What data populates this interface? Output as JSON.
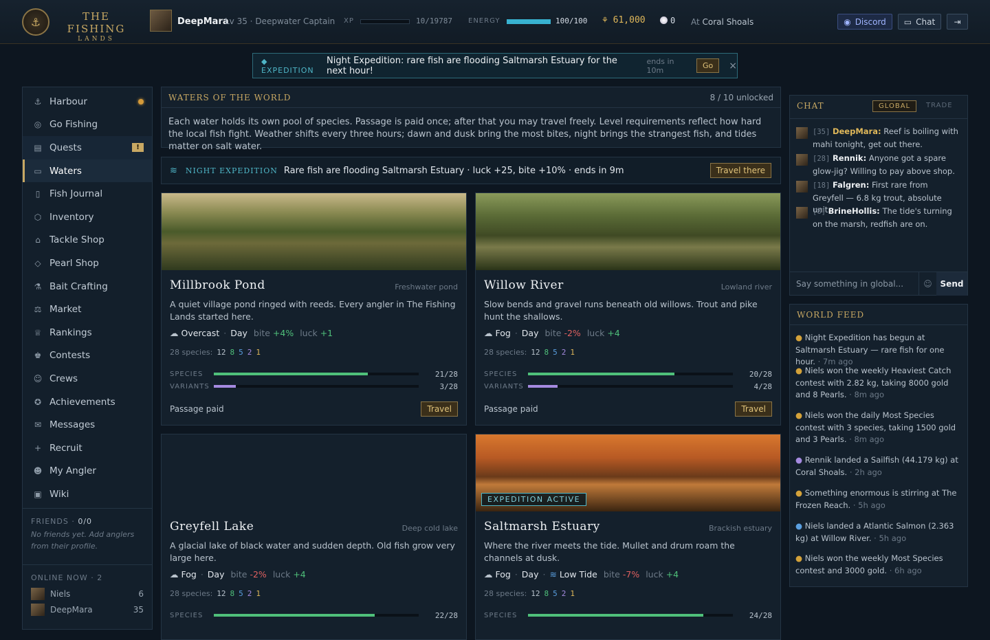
{
  "brand": {
    "line1": "THE FISHING",
    "line2": "LANDS"
  },
  "user": {
    "name": "DeepMara",
    "rank": "Lv 35 · Deepwater Captain",
    "xp_label": "XP",
    "xp_value": "10/19787",
    "xp_fraction": 0.0005,
    "energy_label": "ENERGY",
    "energy_value": "100/100",
    "energy_fraction": 1.0,
    "gold": "61,000",
    "pearls": "0",
    "location_prefix": "At",
    "location": "Coral Shoals"
  },
  "top_buttons": {
    "discord": "Discord",
    "chat": "Chat"
  },
  "banner": {
    "tag": "EXPEDITION",
    "message": "Night Expedition: rare fish are flooding Saltmarsh Estuary for the next hour!",
    "ends": "ends in 10m",
    "go": "Go",
    "close": "×"
  },
  "nav": [
    {
      "label": "Harbour",
      "icon": "⚓",
      "name": "harbour",
      "dot": true
    },
    {
      "label": "Go Fishing",
      "icon": "◎",
      "name": "go-fishing"
    },
    {
      "label": "Quests",
      "icon": "▤",
      "name": "quests",
      "badge": "!"
    },
    {
      "label": "Waters",
      "icon": "▭",
      "name": "waters",
      "active": true
    },
    {
      "label": "Fish Journal",
      "icon": "▯",
      "name": "fish-journal"
    },
    {
      "label": "Inventory",
      "icon": "⬡",
      "name": "inventory"
    },
    {
      "label": "Tackle Shop",
      "icon": "⌂",
      "name": "tackle-shop"
    },
    {
      "label": "Pearl Shop",
      "icon": "◇",
      "name": "pearl-shop"
    },
    {
      "label": "Bait Crafting",
      "icon": "⚗",
      "name": "bait-crafting"
    },
    {
      "label": "Market",
      "icon": "⚖",
      "name": "market"
    },
    {
      "label": "Rankings",
      "icon": "♕",
      "name": "rankings"
    },
    {
      "label": "Contests",
      "icon": "♚",
      "name": "contests"
    },
    {
      "label": "Crews",
      "icon": "☺",
      "name": "crews"
    },
    {
      "label": "Achievements",
      "icon": "✪",
      "name": "achievements"
    },
    {
      "label": "Messages",
      "icon": "✉",
      "name": "messages"
    },
    {
      "label": "Recruit",
      "icon": "+",
      "name": "recruit"
    },
    {
      "label": "My Angler",
      "icon": "☻",
      "name": "my-angler"
    },
    {
      "label": "Wiki",
      "icon": "▣",
      "name": "wiki"
    }
  ],
  "friends": {
    "label": "FRIENDS ·",
    "count": "0/0",
    "note": "No friends yet. Add anglers from their profile."
  },
  "online": {
    "label": "ONLINE NOW · 2",
    "users": [
      {
        "name": "Niels",
        "level": "6"
      },
      {
        "name": "DeepMara",
        "level": "35"
      }
    ]
  },
  "waters": {
    "title": "WATERS OF THE WORLD",
    "unlocked": "8 / 10 unlocked",
    "description": "Each water holds its own pool of species. Passage is paid once; after that you may travel freely. Level requirements reflect how hard the local fish fight. Weather shifts every three hours; dawn and dusk bring the most bites, night brings the strangest fish, and tides matter on salt water."
  },
  "night": {
    "tag": "NIGHT EXPEDITION",
    "message": "Rare fish are flooding Saltmarsh Estuary · luck +25, bite +10% · ends in 9m",
    "button": "Travel there"
  },
  "cards": [
    {
      "name": "Millbrook Pond",
      "type": "Freshwater pond",
      "desc": "A quiet village pond ringed with reeds. Every angler in The Fishing Lands started here.",
      "weather": "Overcast",
      "time": "Day",
      "bite_label": "bite",
      "bite": "+4%",
      "bite_pos": true,
      "luck_label": "luck",
      "luck": "+1",
      "species_label": "28 species:",
      "tiers": [
        "12",
        "8",
        "5",
        "2",
        "1"
      ],
      "species_text": "21/28",
      "species_frac": 0.75,
      "variants_text": "3/28",
      "variants_frac": 0.107,
      "paid": "Passage paid",
      "travel": "Travel",
      "image": "village-pond-with-watermill"
    },
    {
      "name": "Willow River",
      "type": "Lowland river",
      "desc": "Slow bends and gravel runs beneath old willows. Trout and pike hunt the shallows.",
      "weather": "Fog",
      "time": "Day",
      "bite_label": "bite",
      "bite": "-2%",
      "bite_pos": false,
      "luck_label": "luck",
      "luck": "+4",
      "species_label": "28 species:",
      "tiers": [
        "12",
        "8",
        "5",
        "2",
        "1"
      ],
      "species_text": "20/28",
      "species_frac": 0.714,
      "variants_text": "4/28",
      "variants_frac": 0.143,
      "paid": "Passage paid",
      "travel": "Travel",
      "image": "willow-river"
    },
    {
      "name": "Greyfell Lake",
      "type": "Deep cold lake",
      "desc": "A glacial lake of black water and sudden depth. Old fish grow very large here.",
      "weather": "Fog",
      "time": "Day",
      "bite_label": "bite",
      "bite": "-2%",
      "bite_pos": false,
      "luck_label": "luck",
      "luck": "+4",
      "species_label": "28 species:",
      "tiers": [
        "12",
        "8",
        "5",
        "2",
        "1"
      ],
      "species_text": "22/28",
      "species_frac": 0.786,
      "image": ""
    },
    {
      "name": "Saltmarsh Estuary",
      "type": "Brackish estuary",
      "desc": "Where the river meets the tide. Mullet and drum roam the channels at dusk.",
      "weather": "Fog",
      "time": "Day",
      "tide": "Low Tide",
      "bite_label": "bite",
      "bite": "-7%",
      "bite_pos": false,
      "luck_label": "luck",
      "luck": "+4",
      "species_label": "28 species:",
      "tiers": [
        "12",
        "8",
        "5",
        "2",
        "1"
      ],
      "species_text": "24/28",
      "species_frac": 0.857,
      "badge": "EXPEDITION ACTIVE",
      "image": "estuary-sunset-cabin"
    }
  ],
  "labels": {
    "species": "SPECIES",
    "variants": "VARIANTS"
  },
  "chat": {
    "title": "CHAT",
    "tab_global": "GLOBAL",
    "tab_trade": "TRADE",
    "placeholder": "Say something in global...",
    "send": "Send",
    "messages": [
      {
        "level": "[35]",
        "name": "DeepMara:",
        "text": "Reef is boiling with mahi tonight, get out there.",
        "me": true
      },
      {
        "level": "[28]",
        "name": "Rennik:",
        "text": "Anyone got a spare glow-jig? Willing to pay above shop."
      },
      {
        "level": "[18]",
        "name": "Falgren:",
        "text": "First rare from Greyfell — 6.8 kg trout, absolute unit."
      },
      {
        "level": "[8]",
        "name": "BrineHollis:",
        "text": "The tide's turning on the marsh, redfish are on."
      }
    ]
  },
  "feed": {
    "title": "WORLD FEED",
    "items": [
      {
        "text": "Night Expedition has begun at Saltmarsh Estuary — rare fish for one hour.",
        "ago": "· 7m ago",
        "kind": "gold"
      },
      {
        "text": "Niels won the weekly Heaviest Catch contest with 2.82 kg, taking 8000 gold and 8 Pearls.",
        "ago": "· 8m ago",
        "kind": "gold"
      },
      {
        "text": "Niels won the daily Most Species contest with 3 species, taking 1500 gold and 3 Pearls.",
        "ago": "· 8m ago",
        "kind": "gold"
      },
      {
        "text": "Rennik landed a Sailfish (44.179 kg) at Coral Shoals.",
        "ago": "· 2h ago",
        "kind": "purple"
      },
      {
        "text": "Something enormous is stirring at The Frozen Reach.",
        "ago": "· 5h ago",
        "kind": "gold"
      },
      {
        "text": "Niels landed a Atlantic Salmon (2.363 kg) at Willow River.",
        "ago": "· 5h ago",
        "kind": "blue"
      },
      {
        "text": "Niels won the weekly Most Species contest and 3000 gold.",
        "ago": "· 6h ago",
        "kind": "gold"
      }
    ]
  }
}
